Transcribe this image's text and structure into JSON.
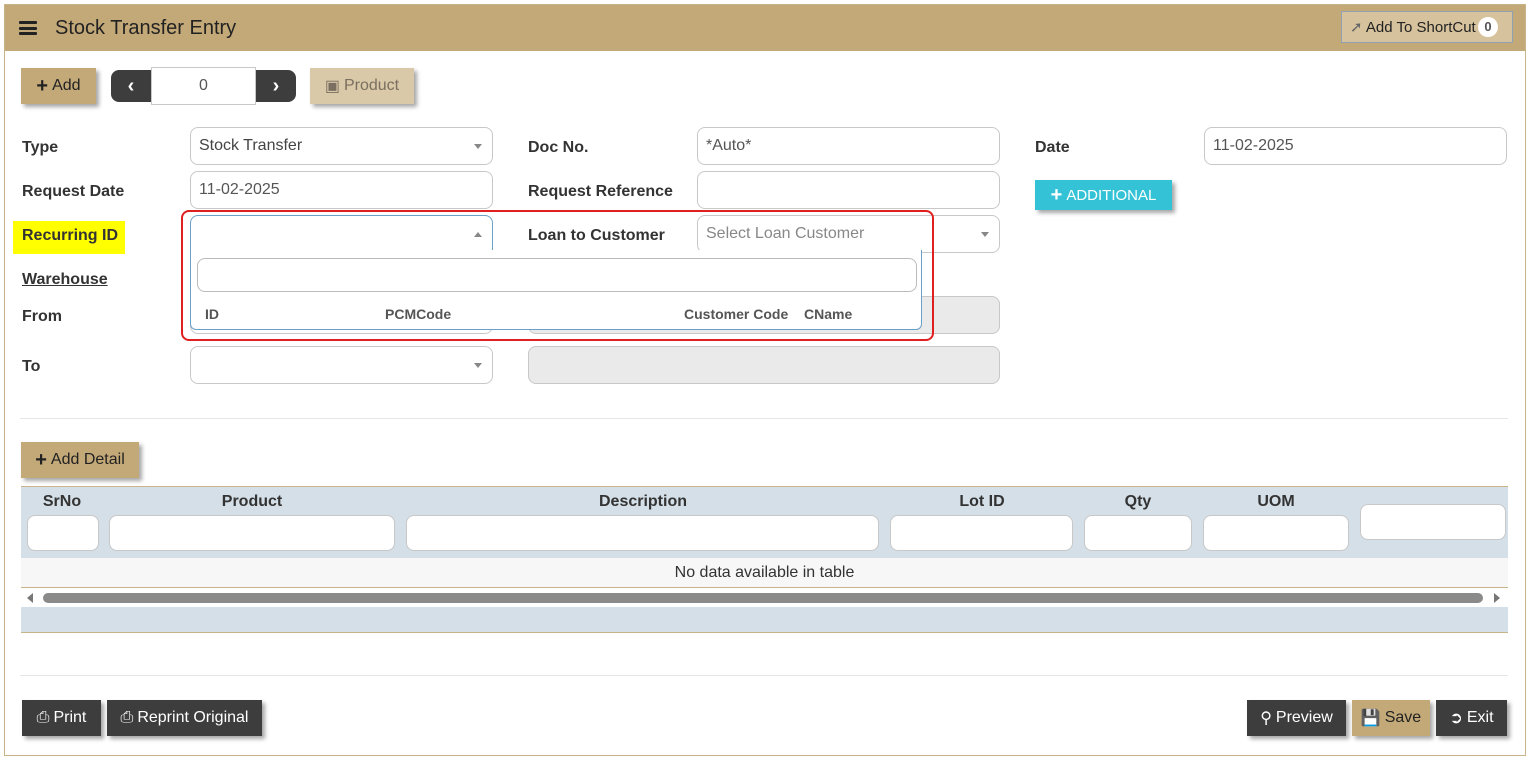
{
  "header": {
    "title": "Stock Transfer Entry",
    "shortcut_label": "Add To ShortCut",
    "shortcut_count": "0"
  },
  "toolbar": {
    "add_label": "Add",
    "record_number": "0",
    "product_label": "Product"
  },
  "form": {
    "type_label": "Type",
    "type_value": "Stock Transfer",
    "docno_label": "Doc No.",
    "docno_value": "*Auto*",
    "date_label": "Date",
    "date_value": "11-02-2025",
    "request_date_label": "Request Date",
    "request_date_value": "11-02-2025",
    "request_ref_label": "Request Reference",
    "request_ref_value": "",
    "additional_label": "ADDITIONAL",
    "recurring_label": "Recurring ID",
    "loan_label": "Loan to Customer",
    "loan_placeholder": "Select Loan Customer",
    "warehouse_label": "Warehouse",
    "from_label": "From",
    "to_label": "To"
  },
  "dropdown": {
    "columns": [
      "ID",
      "PCMCode",
      "Customer Code",
      "CName"
    ]
  },
  "detail": {
    "add_detail_label": "Add Detail",
    "columns": [
      "SrNo",
      "Product",
      "Description",
      "Lot ID",
      "Qty",
      "UOM"
    ],
    "empty_text": "No data available in table"
  },
  "footer": {
    "print_label": "Print",
    "reprint_label": "Reprint Original",
    "preview_label": "Preview",
    "save_label": "Save",
    "exit_label": "Exit"
  },
  "colors": {
    "brand": "#c4a978",
    "accent_teal": "#33c2d6",
    "dark_button": "#3d3d3d",
    "highlight": "#ffff00",
    "annotation_red": "#e02020"
  }
}
